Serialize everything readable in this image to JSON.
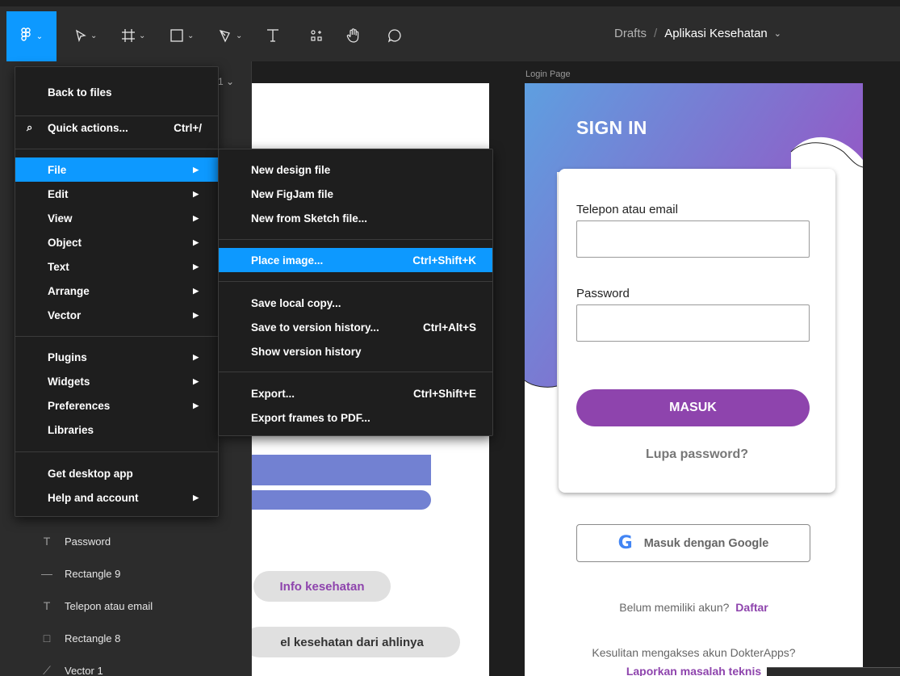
{
  "toolbar": {
    "breadcrumb_root": "Drafts",
    "breadcrumb_sep": "/",
    "file_name": "Aplikasi Kesehatan",
    "caret": "⌄"
  },
  "left_panel": {
    "page_indicator": "1 ⌄",
    "layers": [
      {
        "icon": "T",
        "label": "Password"
      },
      {
        "icon": "—",
        "label": "Rectangle 9"
      },
      {
        "icon": "T",
        "label": "Telepon atau email"
      },
      {
        "icon": "□",
        "label": "Rectangle 8"
      },
      {
        "icon": "⟋",
        "label": "Vector 1"
      }
    ]
  },
  "main_menu": {
    "back": "Back to files",
    "quick_actions": "Quick actions...",
    "quick_actions_shortcut": "Ctrl+/",
    "items": [
      "File",
      "Edit",
      "View",
      "Object",
      "Text",
      "Arrange",
      "Vector"
    ],
    "items2": [
      "Plugins",
      "Widgets",
      "Preferences",
      "Libraries"
    ],
    "items3": [
      "Get desktop app",
      "Help and account"
    ]
  },
  "file_menu": {
    "new_design": "New design file",
    "new_figjam": "New FigJam file",
    "new_sketch": "New from Sketch file...",
    "place_image": "Place image...",
    "place_image_shortcut": "Ctrl+Shift+K",
    "save_local": "Save local copy...",
    "save_version": "Save to version history...",
    "save_version_shortcut": "Ctrl+Alt+S",
    "show_version": "Show version history",
    "export": "Export...",
    "export_shortcut": "Ctrl+Shift+E",
    "export_pdf": "Export frames to PDF..."
  },
  "canvas": {
    "left_frame": {
      "pill1": "Info kesehatan",
      "pill2": "el kesehatan dari ahlinya"
    },
    "login_frame": {
      "frame_label": "Login Page",
      "title": "SIGN IN",
      "phone_label": "Telepon atau email",
      "password_label": "Password",
      "submit": "MASUK",
      "forgot": "Lupa password?",
      "google": "Masuk dengan Google",
      "google_glyph": "G",
      "signup_prompt": "Belum memiliki akun?",
      "signup_link": "Daftar",
      "help_prompt": "Kesulitan mengakses akun DokterApps?",
      "report_link": "Laporkan masalah teknis"
    }
  },
  "colors": {
    "accent": "#0d99ff",
    "brand_purple": "#8e44ad",
    "gradient_start": "#5e9fe0",
    "gradient_end": "#9b4fc2"
  }
}
